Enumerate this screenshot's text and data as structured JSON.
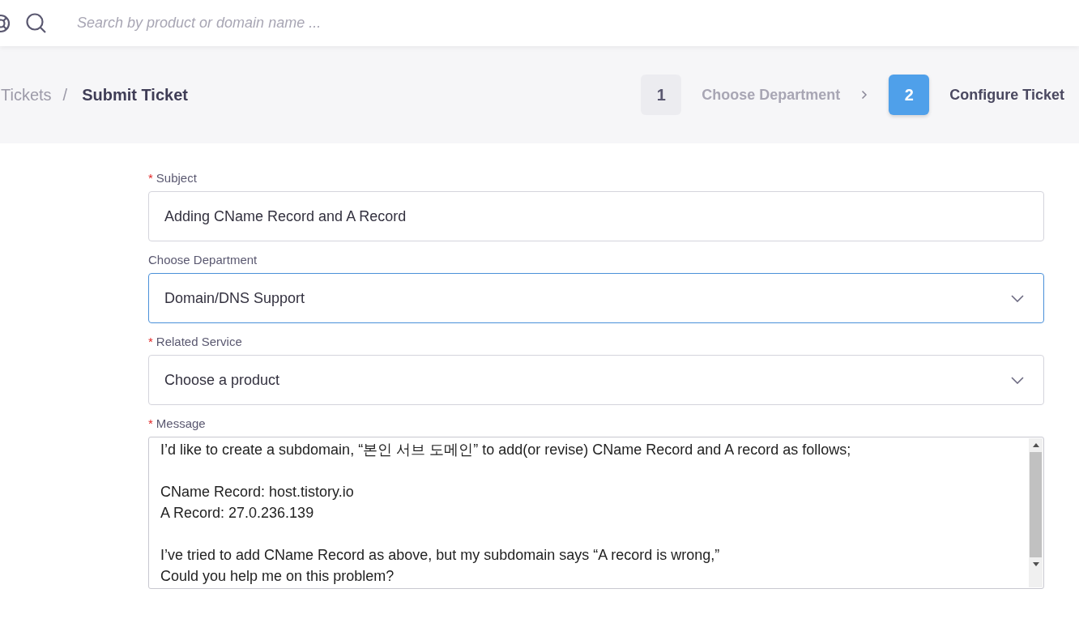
{
  "top_bar": {
    "search": {
      "placeholder": "Search by product or domain name ..."
    }
  },
  "breadcrumb": {
    "parent": "Tickets",
    "separator": "/",
    "current": "Submit Ticket"
  },
  "steps": [
    {
      "number": "1",
      "label": "Choose Department",
      "selected": false
    },
    {
      "number": "2",
      "label": "Configure Ticket",
      "selected": true
    }
  ],
  "fields": [
    {
      "kind": "input",
      "label": "Subject",
      "required_mark": "*",
      "value": "Adding CName Record and A Record",
      "focused": false
    },
    {
      "kind": "select",
      "label": "Choose Department",
      "value": "Domain/DNS Support",
      "focused": true
    },
    {
      "kind": "select",
      "label": "Related Service",
      "required_mark": "*",
      "value": "Choose a product",
      "focused": false
    },
    {
      "kind": "textarea",
      "label": "Message",
      "required_mark": "*",
      "value": "I’d like to create a subdomain, “본인 서브 도메인” to add(or revise) CName Record and A record as follows;\n\nCName Record: host.tistory.io\nA Record: 27.0.236.139\n\nI’ve tried to add CName Record as above, but my subdomain says “A record is wrong,”\nCould you help me on this problem?",
      "focused": false
    }
  ]
}
